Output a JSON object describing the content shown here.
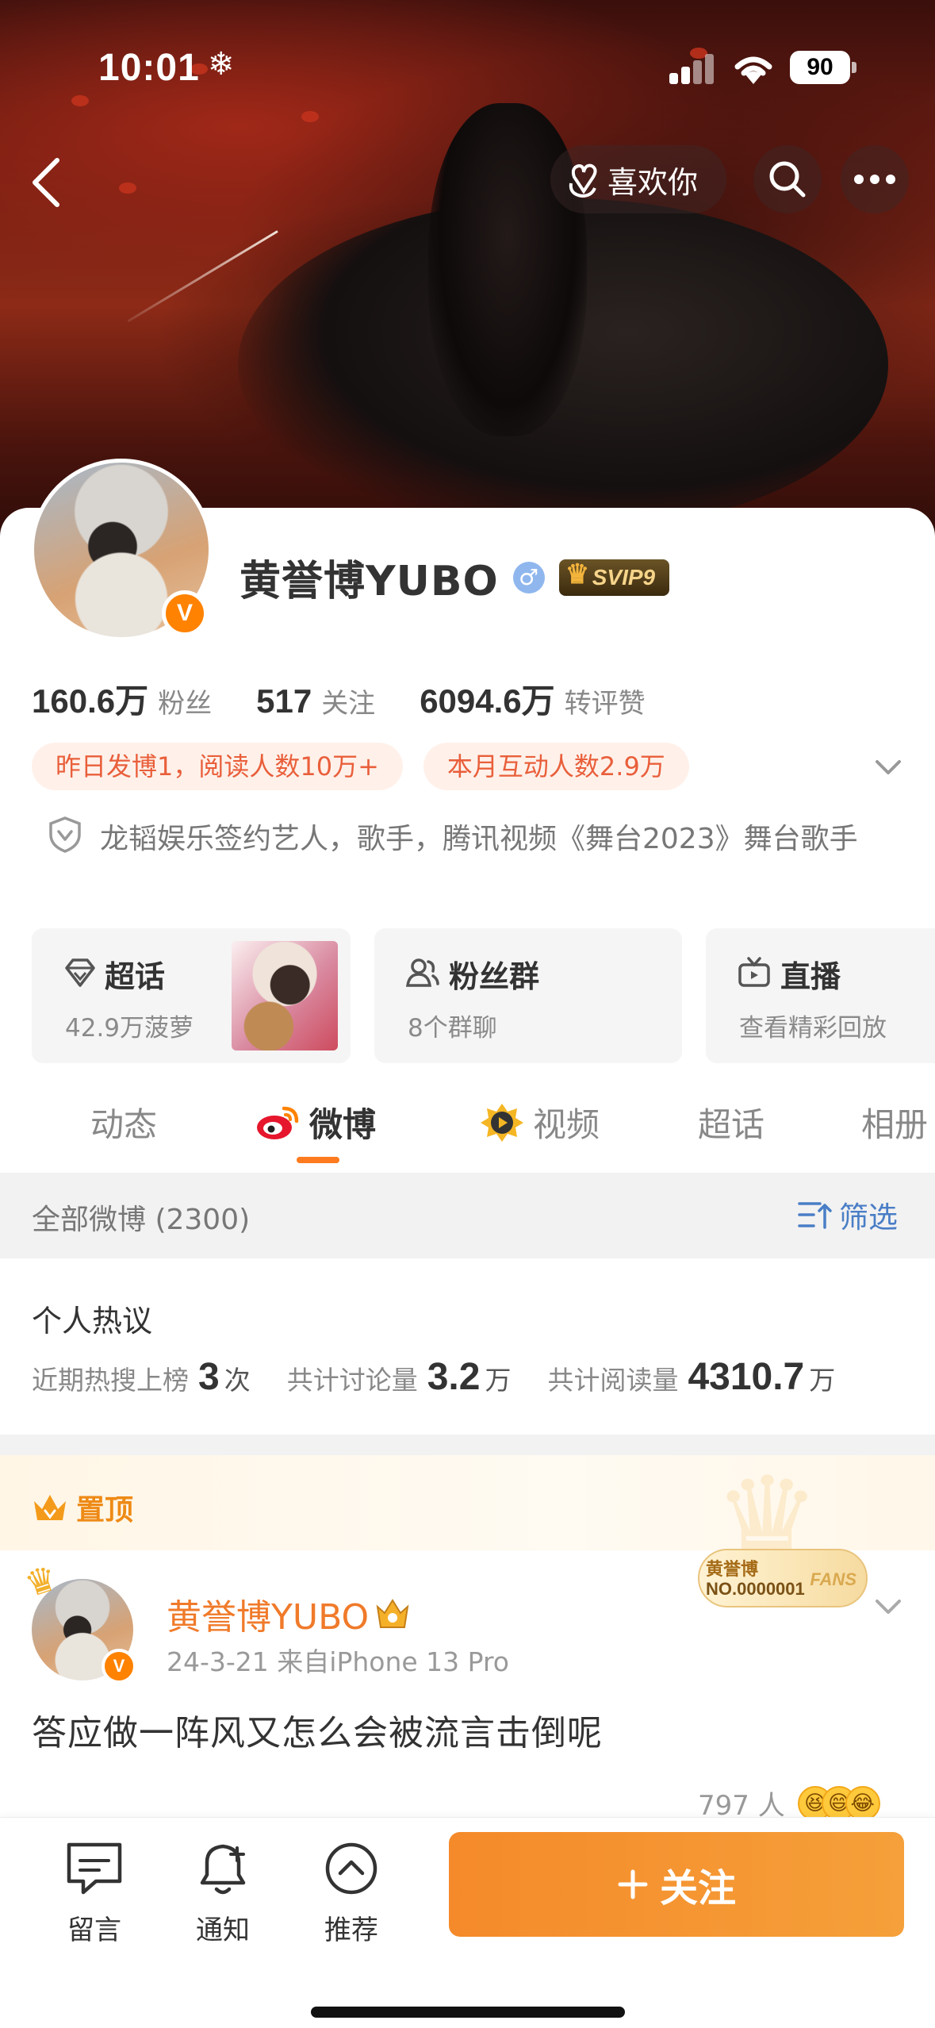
{
  "status_bar": {
    "time": "10:01",
    "weather_icon": "snowflake-icon",
    "battery": "90"
  },
  "header": {
    "like_label": "喜欢你"
  },
  "profile": {
    "name": "黄誉博YUBO",
    "gender_symbol": "♂",
    "vip_badge": "SVIP9",
    "verified_mark": "V",
    "stats": [
      {
        "value": "160.6万",
        "label": "粉丝"
      },
      {
        "value": "517",
        "label": "关注"
      },
      {
        "value": "6094.6万",
        "label": "转评赞"
      }
    ],
    "chips": [
      "昨日发博1，阅读人数10万+",
      "本月互动人数2.9万"
    ],
    "verification": "龙韬娱乐签约艺人，歌手，腾讯视频《舞台2023》舞台歌手"
  },
  "shortcuts": [
    {
      "title": "超话",
      "subtitle": "42.9万菠萝",
      "icon": "diamond-icon"
    },
    {
      "title": "粉丝群",
      "subtitle": "8个群聊",
      "icon": "group-icon"
    },
    {
      "title": "直播",
      "subtitle": "查看精彩回放",
      "icon": "tv-icon"
    }
  ],
  "tabs": [
    {
      "label": "动态"
    },
    {
      "label": "微博"
    },
    {
      "label": "视频"
    },
    {
      "label": "超话"
    },
    {
      "label": "相册"
    }
  ],
  "filter": {
    "title": "全部微博 (2300)",
    "button": "筛选"
  },
  "hot": {
    "title": "个人热议",
    "items": [
      {
        "label": "近期热搜上榜",
        "value": "3",
        "unit": "次"
      },
      {
        "label": "共计讨论量",
        "value": "3.2",
        "unit": "万"
      },
      {
        "label": "共计阅读量",
        "value": "4310.7",
        "unit": "万"
      }
    ]
  },
  "pinned": {
    "label": "置顶",
    "fans_badge": {
      "name": "黄誉博",
      "number": "NO.0000001",
      "tag": "FANS"
    },
    "post": {
      "author": "黄誉博YUBO",
      "meta": "24-3-21  来自iPhone 13 Pro",
      "text": "答应做一阵风又怎么会被流言击倒呢",
      "reactions": "797 人"
    }
  },
  "bottom_bar": {
    "items": [
      {
        "label": "留言",
        "icon": "comment-icon"
      },
      {
        "label": "通知",
        "icon": "bell-icon"
      },
      {
        "label": "推荐",
        "icon": "recommend-icon"
      }
    ],
    "follow": "关注"
  },
  "colors": {
    "accent": "#ff8200",
    "follow": "#f58a2a",
    "link": "#4a7ec6"
  }
}
